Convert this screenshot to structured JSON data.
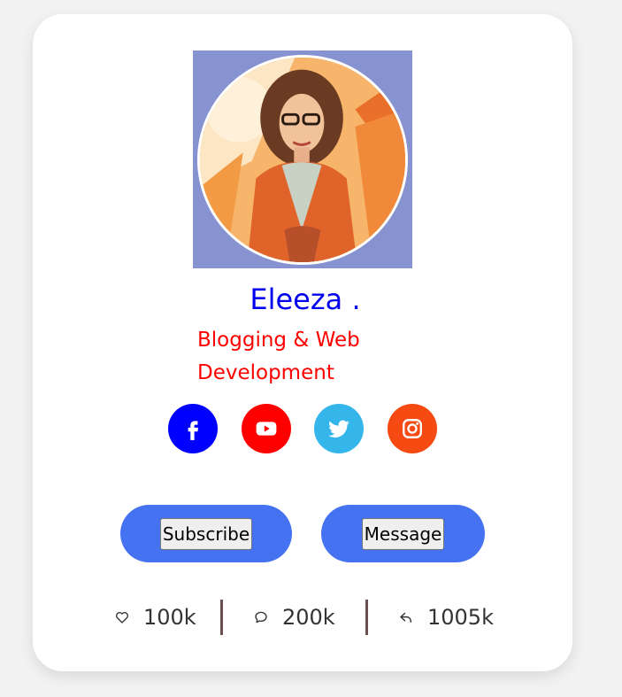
{
  "profile": {
    "name": "Eleeza .",
    "role": "Blogging & Web Development"
  },
  "socials": [
    {
      "name": "facebook",
      "icon": "facebook-icon",
      "color": "#0000ff"
    },
    {
      "name": "youtube",
      "icon": "youtube-icon",
      "color": "#ff0000"
    },
    {
      "name": "twitter",
      "icon": "twitter-icon",
      "color": "#35b6ea"
    },
    {
      "name": "instagram",
      "icon": "instagram-icon",
      "color": "#f54b12"
    }
  ],
  "actions": {
    "subscribe_label": "Subscribe",
    "message_label": "Message",
    "pill_color": "#4572f0"
  },
  "stats": [
    {
      "icon": "heart-icon",
      "value": "100k"
    },
    {
      "icon": "comment-icon",
      "value": "200k"
    },
    {
      "icon": "share-icon",
      "value": "1005k"
    }
  ],
  "colors": {
    "name": "#0000ee",
    "role": "#ff0000",
    "avatar_frame": "#8793d0"
  }
}
